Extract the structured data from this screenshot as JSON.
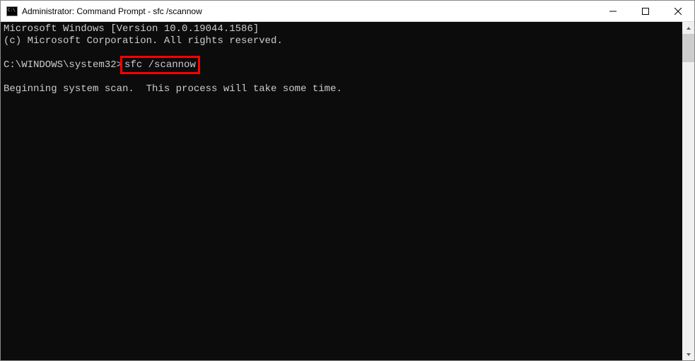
{
  "titlebar": {
    "title": "Administrator: Command Prompt - sfc  /scannow"
  },
  "terminal": {
    "line1": "Microsoft Windows [Version 10.0.19044.1586]",
    "line2": "(c) Microsoft Corporation. All rights reserved.",
    "prompt": "C:\\WINDOWS\\system32>",
    "command": "sfc /scannow",
    "line3": "Beginning system scan.  This process will take some time."
  }
}
